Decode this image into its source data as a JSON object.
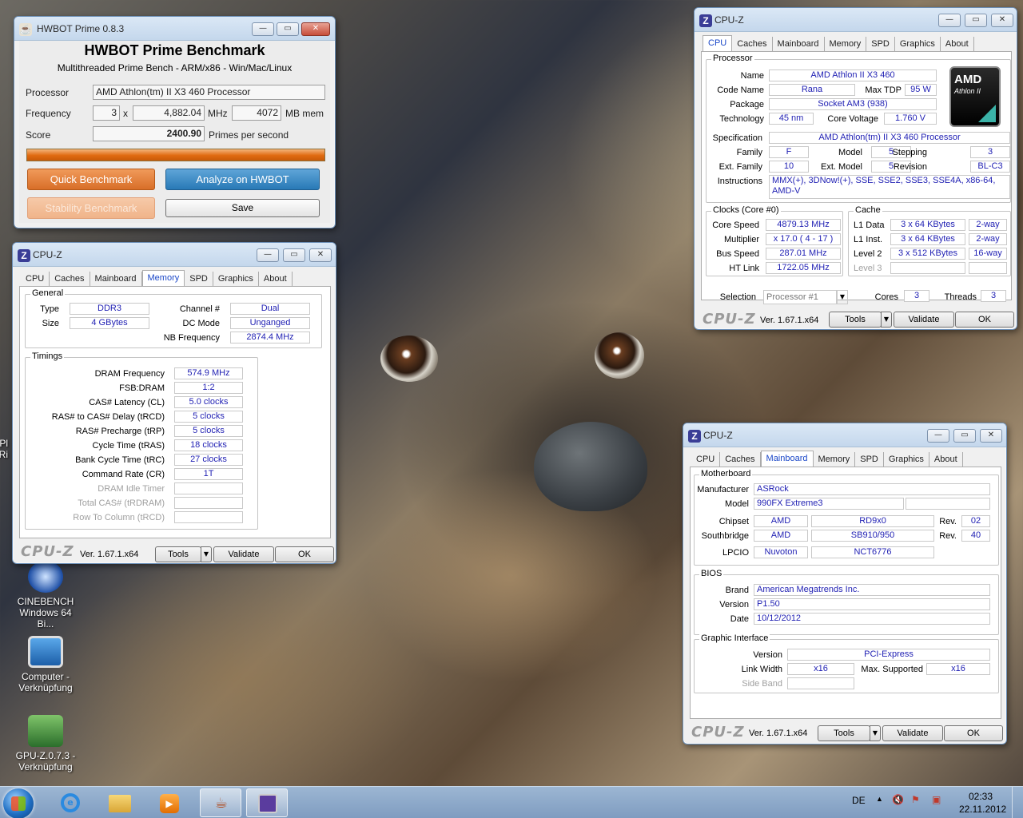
{
  "desktop": {
    "icons": [
      {
        "label1": "CINEBENCH",
        "label2": "Windows 64 Bi..."
      },
      {
        "label1": "Computer -",
        "label2": "Verknüpfung"
      },
      {
        "label1": "GPU-Z.0.7.3 -",
        "label2": "Verknüpfung"
      }
    ],
    "cut_labels": [
      "Pl",
      "Ri"
    ]
  },
  "hwbot": {
    "window_title": "HWBOT Prime 0.8.3",
    "heading": "HWBOT Prime Benchmark",
    "subheading": "Multithreaded Prime Bench - ARM/x86 - Win/Mac/Linux",
    "processor_label": "Processor",
    "processor_value": "AMD Athlon(tm) II X3 460 Processor",
    "frequency_label": "Frequency",
    "cores": "3",
    "times": "x",
    "frequency": "4,882.04",
    "mhz": "MHz",
    "mem": "4072",
    "mem_unit": "MB mem",
    "score_label": "Score",
    "score": "2400.90",
    "score_unit": "Primes per second",
    "progress": 1.0,
    "quick_btn": "Quick Benchmark",
    "analyze_btn": "Analyze on HWBOT",
    "stability_btn": "Stability Benchmark",
    "save_btn": "Save"
  },
  "cpuz_tabs": [
    "CPU",
    "Caches",
    "Mainboard",
    "Memory",
    "SPD",
    "Graphics",
    "About"
  ],
  "cpuz_common": {
    "title": "CPU-Z",
    "logo": "CPU-Z",
    "version": "Ver. 1.67.1.x64",
    "tools": "Tools",
    "validate": "Validate",
    "ok": "OK"
  },
  "cpuz_cpu": {
    "processor_group": "Processor",
    "name_label": "Name",
    "name": "AMD Athlon II X3 460",
    "codename_label": "Code Name",
    "codename": "Rana",
    "maxtdp_label": "Max TDP",
    "maxtdp": "95 W",
    "package_label": "Package",
    "package": "Socket AM3 (938)",
    "technology_label": "Technology",
    "technology": "45 nm",
    "corevoltage_label": "Core Voltage",
    "corevoltage": "1.760 V",
    "spec_label": "Specification",
    "spec": "AMD Athlon(tm) II X3 460 Processor",
    "family_label": "Family",
    "family": "F",
    "model_label": "Model",
    "model": "5",
    "stepping_label": "Stepping",
    "stepping": "3",
    "extfamily_label": "Ext. Family",
    "extfamily": "10",
    "extmodel_label": "Ext. Model",
    "extmodel": "5",
    "revision_label": "Revision",
    "revision": "BL-C3",
    "instructions_label": "Instructions",
    "instructions1": "MMX(+), 3DNow!(+), SSE, SSE2, SSE3, SSE4A, x86-64,",
    "instructions2": "AMD-V",
    "logo_brand": "AMD",
    "logo_line": "Athlon II",
    "clocks_group": "Clocks (Core #0)",
    "corespeed_label": "Core Speed",
    "corespeed": "4879.13 MHz",
    "multiplier_label": "Multiplier",
    "multiplier": "x 17.0 ( 4 - 17 )",
    "busspeed_label": "Bus Speed",
    "busspeed": "287.01 MHz",
    "htlink_label": "HT Link",
    "htlink": "1722.05 MHz",
    "cache_group": "Cache",
    "l1d_label": "L1 Data",
    "l1d": "3 x 64 KBytes",
    "l1d_way": "2-way",
    "l1i_label": "L1 Inst.",
    "l1i": "3 x 64 KBytes",
    "l1i_way": "2-way",
    "l2_label": "Level 2",
    "l2": "3 x 512 KBytes",
    "l2_way": "16-way",
    "l3_label": "Level 3",
    "selection_label": "Selection",
    "selection": "Processor #1",
    "cores_label": "Cores",
    "cores": "3",
    "threads_label": "Threads",
    "threads": "3"
  },
  "cpuz_mem": {
    "general_group": "General",
    "type_label": "Type",
    "type": "DDR3",
    "size_label": "Size",
    "size": "4 GBytes",
    "channel_label": "Channel #",
    "channel": "Dual",
    "dcmode_label": "DC Mode",
    "dcmode": "Unganged",
    "nbfreq_label": "NB Frequency",
    "nbfreq": "2874.4 MHz",
    "timings_group": "Timings",
    "rows": [
      {
        "label": "DRAM Frequency",
        "value": "574.9 MHz"
      },
      {
        "label": "FSB:DRAM",
        "value": "1:2"
      },
      {
        "label": "CAS# Latency (CL)",
        "value": "5.0 clocks"
      },
      {
        "label": "RAS# to CAS# Delay (tRCD)",
        "value": "5 clocks"
      },
      {
        "label": "RAS# Precharge (tRP)",
        "value": "5 clocks"
      },
      {
        "label": "Cycle Time (tRAS)",
        "value": "18 clocks"
      },
      {
        "label": "Bank Cycle Time (tRC)",
        "value": "27 clocks"
      },
      {
        "label": "Command Rate (CR)",
        "value": "1T"
      },
      {
        "label": "DRAM Idle Timer",
        "value": ""
      },
      {
        "label": "Total CAS# (tRDRAM)",
        "value": ""
      },
      {
        "label": "Row To Column (tRCD)",
        "value": ""
      }
    ]
  },
  "cpuz_mb": {
    "motherboard_group": "Motherboard",
    "manufacturer_label": "Manufacturer",
    "manufacturer": "ASRock",
    "model_label": "Model",
    "model": "990FX Extreme3",
    "chipset_label": "Chipset",
    "chipset_vendor": "AMD",
    "chipset": "RD9x0",
    "chipset_rev_label": "Rev.",
    "chipset_rev": "02",
    "southbridge_label": "Southbridge",
    "sb_vendor": "AMD",
    "sb": "SB910/950",
    "sb_rev_label": "Rev.",
    "sb_rev": "40",
    "lpcio_label": "LPCIO",
    "lpcio_vendor": "Nuvoton",
    "lpcio": "NCT6776",
    "bios_group": "BIOS",
    "brand_label": "Brand",
    "brand": "American Megatrends Inc.",
    "version_label": "Version",
    "version": "P1.50",
    "date_label": "Date",
    "date": "10/12/2012",
    "gi_group": "Graphic Interface",
    "gi_version_label": "Version",
    "gi_version": "PCI-Express",
    "linkwidth_label": "Link Width",
    "linkwidth": "x16",
    "maxsup_label": "Max. Supported",
    "maxsup": "x16",
    "sideband_label": "Side Band"
  },
  "taskbar": {
    "lang": "DE",
    "time": "02:33",
    "date": "22.11.2012"
  }
}
